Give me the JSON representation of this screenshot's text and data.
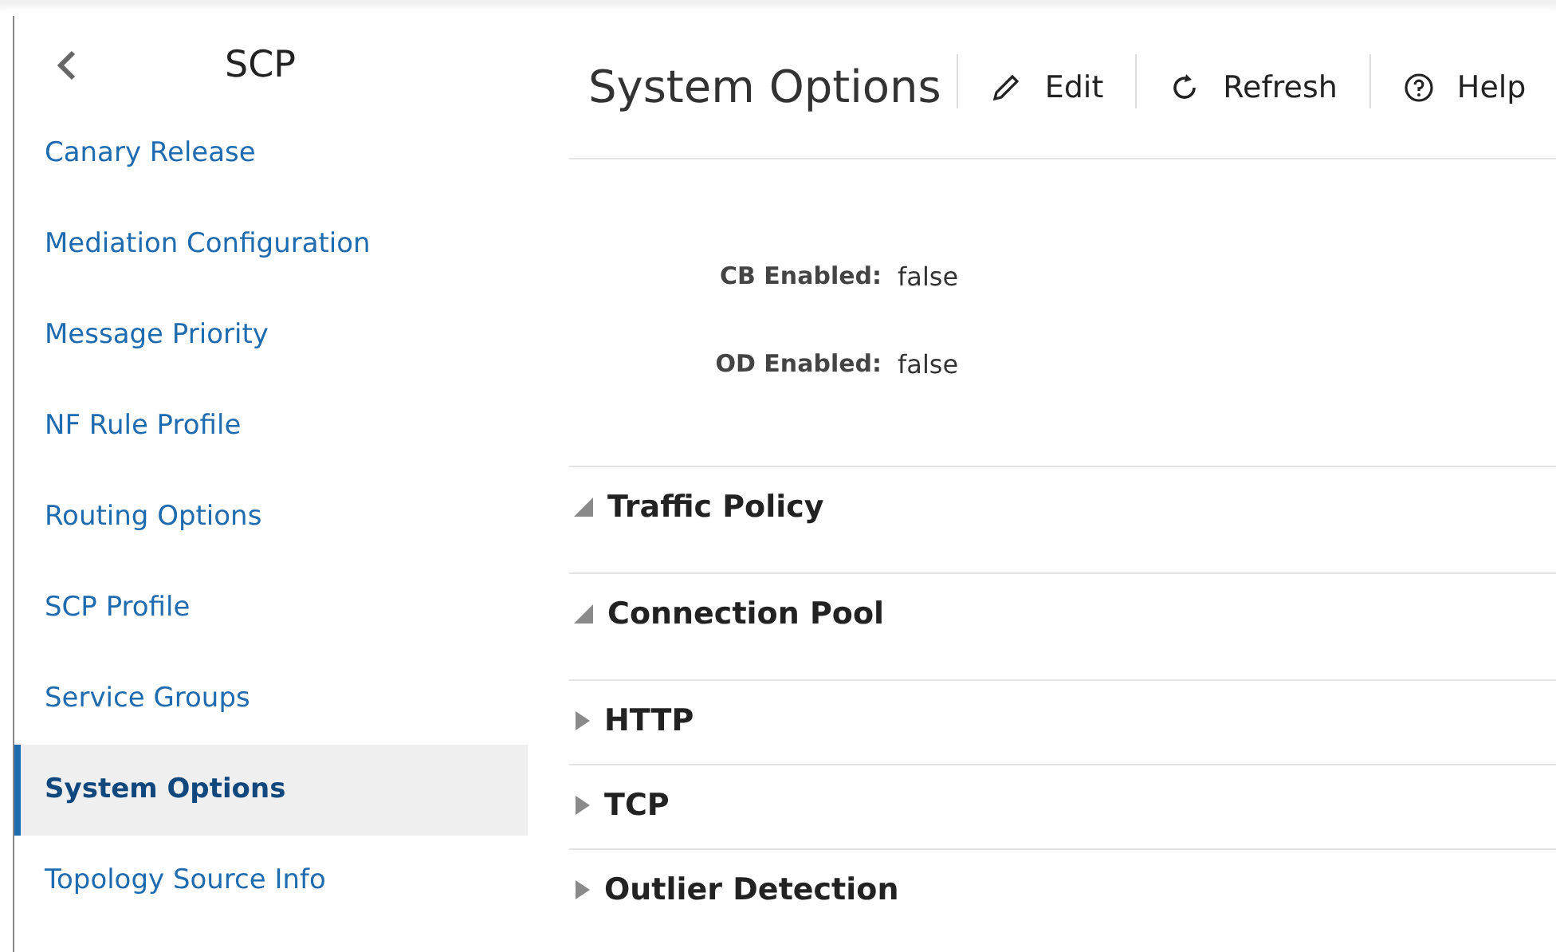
{
  "sidebar": {
    "title": "SCP",
    "items": [
      {
        "label": "Canary Release",
        "selected": false
      },
      {
        "label": "Mediation Configuration",
        "selected": false
      },
      {
        "label": "Message Priority",
        "selected": false
      },
      {
        "label": "NF Rule Profile",
        "selected": false
      },
      {
        "label": "Routing Options",
        "selected": false
      },
      {
        "label": "SCP Profile",
        "selected": false
      },
      {
        "label": "Service Groups",
        "selected": false
      },
      {
        "label": "System Options",
        "selected": true
      },
      {
        "label": "Topology Source Info",
        "selected": false
      }
    ]
  },
  "header": {
    "title": "System Options",
    "actions": [
      {
        "kind": "edit",
        "label": "Edit"
      },
      {
        "kind": "refresh",
        "label": "Refresh"
      },
      {
        "kind": "help",
        "label": "Help"
      }
    ]
  },
  "fields": [
    {
      "label": "CB Enabled:",
      "value": "false"
    },
    {
      "label": "OD Enabled:",
      "value": "false"
    }
  ],
  "sections": [
    {
      "title": "Traffic Policy",
      "expanded": true
    },
    {
      "title": "Connection Pool",
      "expanded": true
    },
    {
      "title": "HTTP",
      "expanded": false
    },
    {
      "title": "TCP",
      "expanded": false
    },
    {
      "title": "Outlier Detection",
      "expanded": false
    }
  ]
}
